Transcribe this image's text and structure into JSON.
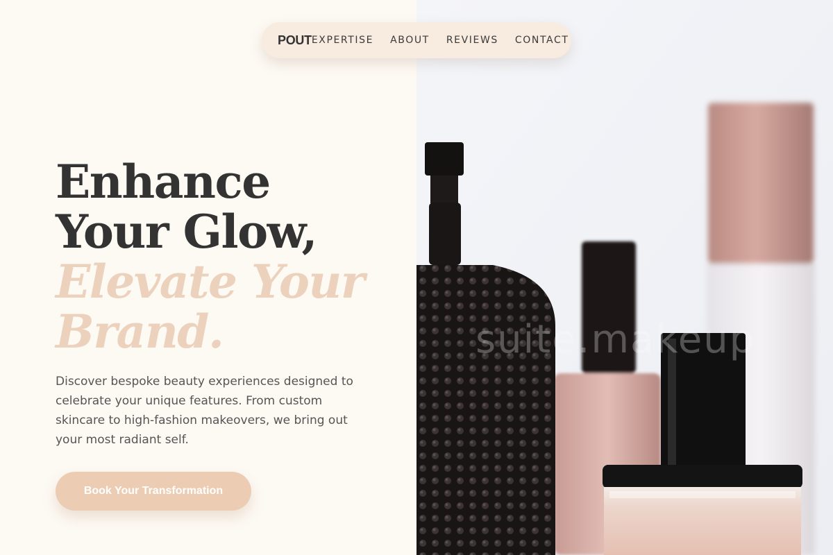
{
  "nav": {
    "logo": "POUT",
    "links": [
      "EXPERTISE",
      "ABOUT",
      "REVIEWS",
      "CONTACT"
    ]
  },
  "hero": {
    "headline_line1": "Enhance",
    "headline_line2": "Your Glow,",
    "headline_accent_line1": "Elevate Your",
    "headline_accent_line2": "Brand.",
    "description": "Discover bespoke beauty experiences designed to celebrate your unique features. From custom skincare to high-fashion makeovers, we bring out your most radiant self.",
    "cta_label": "Book Your Transformation",
    "image_watermark": "suite.makeup"
  },
  "colors": {
    "background": "#fdf9f3",
    "nav_background": "#f8ebe0",
    "accent": "#ecd2bd",
    "button": "#eccdb3",
    "text_dark": "#333333",
    "text_body": "#555555"
  },
  "icons": {
    "hero_image": "perfume-bottles-photo"
  }
}
